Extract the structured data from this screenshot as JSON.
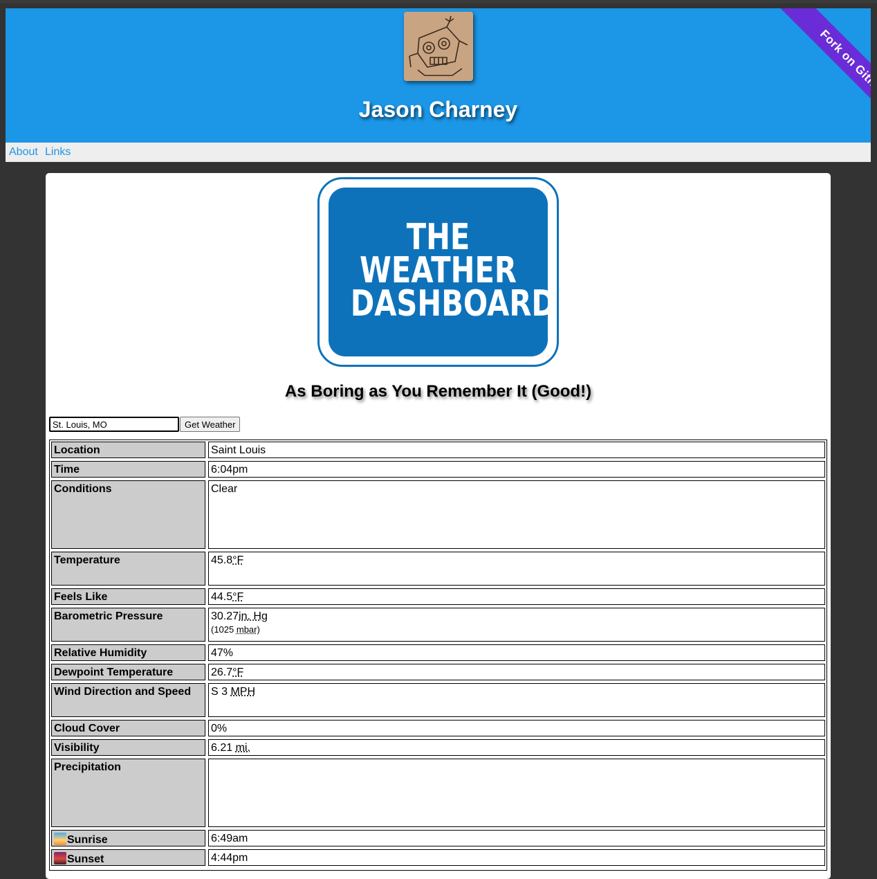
{
  "header": {
    "site_title": "Jason Charney",
    "ribbon_text": "Fork on Github",
    "avatar_icon": "robot-sketch-icon",
    "colors": {
      "header_bg": "#1c96e6",
      "ribbon_bg": "#6a2cd6"
    }
  },
  "nav": {
    "about": "About",
    "links": "Links"
  },
  "logo": {
    "line1": "THE",
    "line2": "WEATHER",
    "line3": "DASHBOARD",
    "color": "#0e72bb"
  },
  "subtitle": "As Boring as You Remember It (Good!)",
  "search": {
    "value": "St. Louis, MO",
    "button_label": "Get Weather"
  },
  "weather": {
    "location": {
      "label": "Location",
      "value": "Saint Louis"
    },
    "time": {
      "label": "Time",
      "value": "6:04pm"
    },
    "conditions": {
      "label": "Conditions",
      "value": "Clear"
    },
    "temperature": {
      "label": "Temperature",
      "value": "45.8",
      "unit": "°F"
    },
    "feels_like": {
      "label": "Feels Like",
      "value": "44.5",
      "unit": "°F"
    },
    "pressure": {
      "label": "Barometric Pressure",
      "value": "30.27",
      "unit": "in. Hg",
      "alt_prefix": "(1025 ",
      "alt_unit": "mbar",
      "alt_suffix": ")"
    },
    "humidity": {
      "label": "Relative Humidity",
      "value": "47%"
    },
    "dewpoint": {
      "label": "Dewpoint Temperature",
      "value": "26.7",
      "unit": "°F"
    },
    "wind": {
      "label": "Wind Direction and Speed",
      "value": "S 3 ",
      "unit": "MPH"
    },
    "cloud_cover": {
      "label": "Cloud Cover",
      "value": "0%"
    },
    "visibility": {
      "label": "Visibility",
      "value": "6.21 ",
      "unit": "mi."
    },
    "precipitation": {
      "label": "Precipitation",
      "value": ""
    },
    "sunrise": {
      "label": "Sunrise",
      "value": "6:49am",
      "icon": "sunrise-icon"
    },
    "sunset": {
      "label": "Sunset",
      "value": "4:44pm",
      "icon": "sunset-icon"
    }
  }
}
